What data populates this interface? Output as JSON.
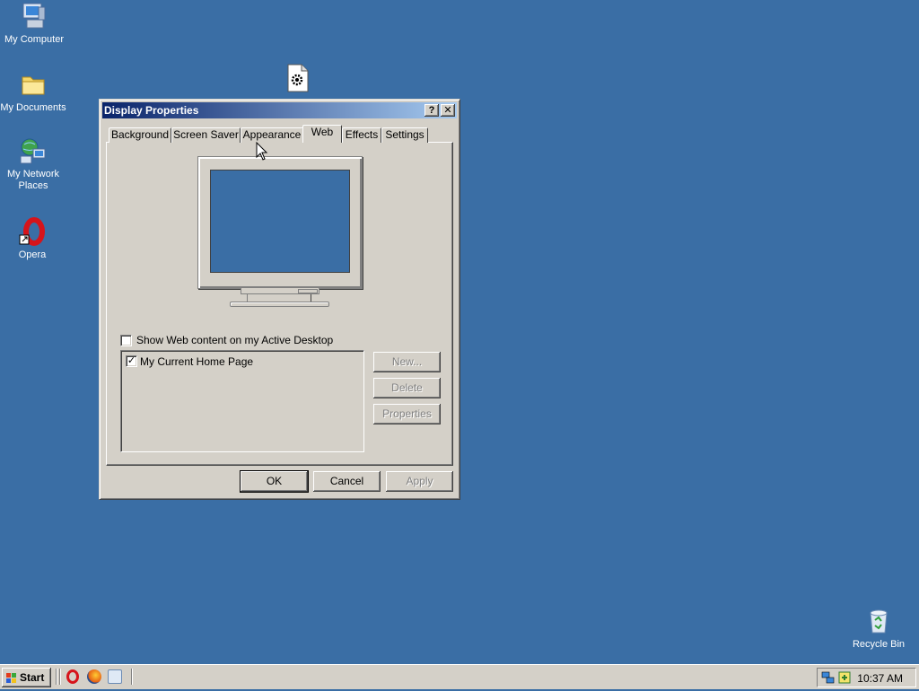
{
  "desktop": {
    "icons": [
      {
        "label": "My Computer",
        "icon": "computer-icon"
      },
      {
        "label": "My Documents",
        "icon": "folder-icon"
      },
      {
        "label": "My Network Places",
        "icon": "network-icon"
      },
      {
        "label": "Opera",
        "icon": "opera-icon"
      },
      {
        "label": "Recycle Bin",
        "icon": "recycle-bin-icon"
      }
    ]
  },
  "window": {
    "title": "Display Properties",
    "help_label": "?",
    "close_label": "✕",
    "tabs": [
      "Background",
      "Screen Saver",
      "Appearance",
      "Web",
      "Effects",
      "Settings"
    ],
    "active_tab": "Web",
    "show_web_label": "Show Web content on my Active Desktop",
    "show_web_checked": false,
    "list_items": [
      {
        "label": "My Current Home Page",
        "checked": true
      }
    ],
    "side_buttons": {
      "new": "New...",
      "delete": "Delete",
      "properties": "Properties"
    },
    "footer": {
      "ok": "OK",
      "cancel": "Cancel",
      "apply": "Apply"
    }
  },
  "taskbar": {
    "start_label": "Start",
    "clock": "10:37 AM"
  },
  "colors": {
    "desktop": "#3a6ea5",
    "title_start": "#0a246a",
    "title_end": "#a6caf0",
    "face": "#d4d0c8"
  }
}
